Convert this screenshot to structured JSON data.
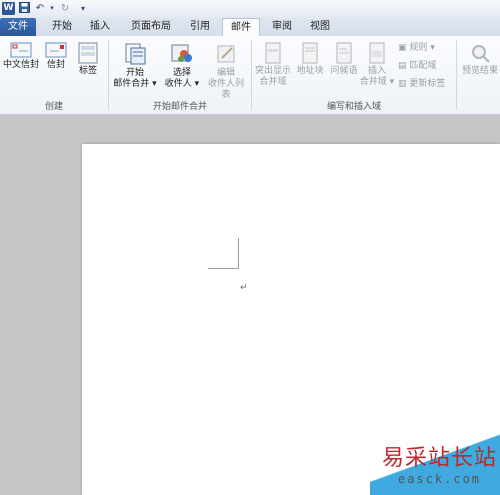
{
  "quick_access": {
    "app_icon": "W"
  },
  "tabs": [
    {
      "label": "文件"
    },
    {
      "label": "开始"
    },
    {
      "label": "插入"
    },
    {
      "label": "页面布局"
    },
    {
      "label": "引用"
    },
    {
      "label": "邮件"
    },
    {
      "label": "审阅"
    },
    {
      "label": "视图"
    }
  ],
  "ribbon": {
    "create": {
      "label": "创建",
      "chinese_envelope": "中文信封",
      "envelope": "信封",
      "labels": "标签"
    },
    "start_merge": {
      "label": "开始邮件合并",
      "start_line1": "开始",
      "start_line2": "邮件合并 ▾",
      "select_line1": "选择",
      "select_line2": "收件人 ▾",
      "edit_line1": "编辑",
      "edit_line2": "收件人列表"
    },
    "write_insert": {
      "label": "编写和插入域",
      "highlight_line1": "突出显示",
      "highlight_line2": "合并域",
      "address_block": "地址块",
      "greeting": "问候语",
      "insert_line1": "插入",
      "insert_line2": "合并域 ▾",
      "rules": "规则 ▾",
      "match_fields": "匹配域",
      "update_labels": "更新标签"
    },
    "preview": {
      "preview_results": "预览结果"
    }
  },
  "document": {
    "paragraph_mark": "↵"
  },
  "watermark": {
    "site_name": "易采站长站",
    "url": "easck.com"
  }
}
